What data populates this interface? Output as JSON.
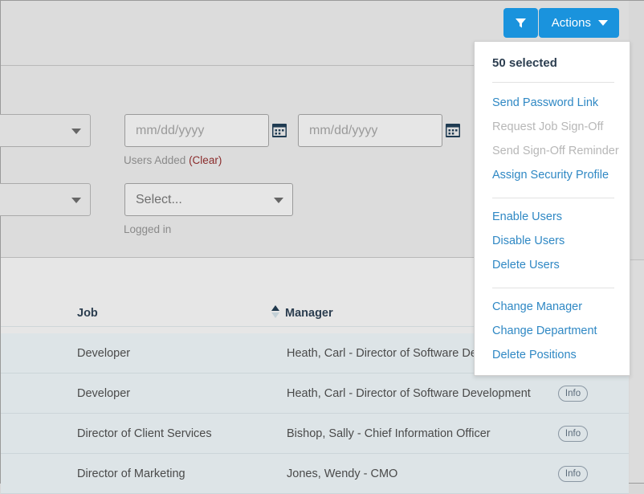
{
  "toolbar": {
    "filter_button_icon": "filter-funnel-icon",
    "actions_label": "Actions",
    "actions_caret_icon": "chevron-down-icon"
  },
  "filters": {
    "users_added": {
      "label": "Users Added",
      "clear_label": "(Clear)",
      "date_from_placeholder": "mm/dd/yyyy",
      "date_to_placeholder": "mm/dd/yyyy",
      "calendar_icon": "calendar-icon"
    },
    "logged_in": {
      "label": "Logged in",
      "select_value": "Select...",
      "caret_icon": "chevron-down-icon"
    },
    "left_select_top": {
      "caret_icon": "chevron-down-icon"
    },
    "left_select_bottom": {
      "caret_icon": "chevron-down-icon"
    }
  },
  "table": {
    "columns": [
      {
        "key": "job",
        "label": "Job"
      },
      {
        "key": "manager",
        "label": "Manager",
        "sorted": "asc"
      }
    ],
    "sort_icon": "sort-ascending-icon",
    "info_label": "Info",
    "rows": [
      {
        "job": "Developer",
        "manager": "Heath, Carl  -  Director of Software Development"
      },
      {
        "job": "Developer",
        "manager": "Heath, Carl  -  Director of Software Development"
      },
      {
        "job": "Director of Client Services",
        "manager": "Bishop, Sally  -  Chief Information Officer"
      },
      {
        "job": "Director of Marketing",
        "manager": "Jones, Wendy  -  CMO"
      }
    ]
  },
  "actions_menu": {
    "title": "50 selected",
    "groups": [
      {
        "items": [
          {
            "label": "Send Password Link",
            "disabled": false
          },
          {
            "label": "Request Job Sign-Off",
            "disabled": true
          },
          {
            "label": "Send Sign-Off Reminder",
            "disabled": true
          },
          {
            "label": "Assign Security Profile",
            "disabled": false
          }
        ]
      },
      {
        "items": [
          {
            "label": "Enable Users",
            "disabled": false
          },
          {
            "label": "Disable Users",
            "disabled": false
          },
          {
            "label": "Delete Users",
            "disabled": false
          }
        ]
      },
      {
        "items": [
          {
            "label": "Change Manager",
            "disabled": false
          },
          {
            "label": "Change Department",
            "disabled": false
          },
          {
            "label": "Delete Positions",
            "disabled": false
          }
        ]
      }
    ]
  },
  "colors": {
    "accent_blue": "#1a93dd",
    "link_blue": "#2f88c4",
    "disabled_gray": "#b7b7b7",
    "clear_red": "#8a2b2b",
    "row_selected": "#dde4e7",
    "panel_gray": "#dcdcdc",
    "header_gray": "#e6e6e6",
    "heading_navy": "#2c3e50"
  }
}
